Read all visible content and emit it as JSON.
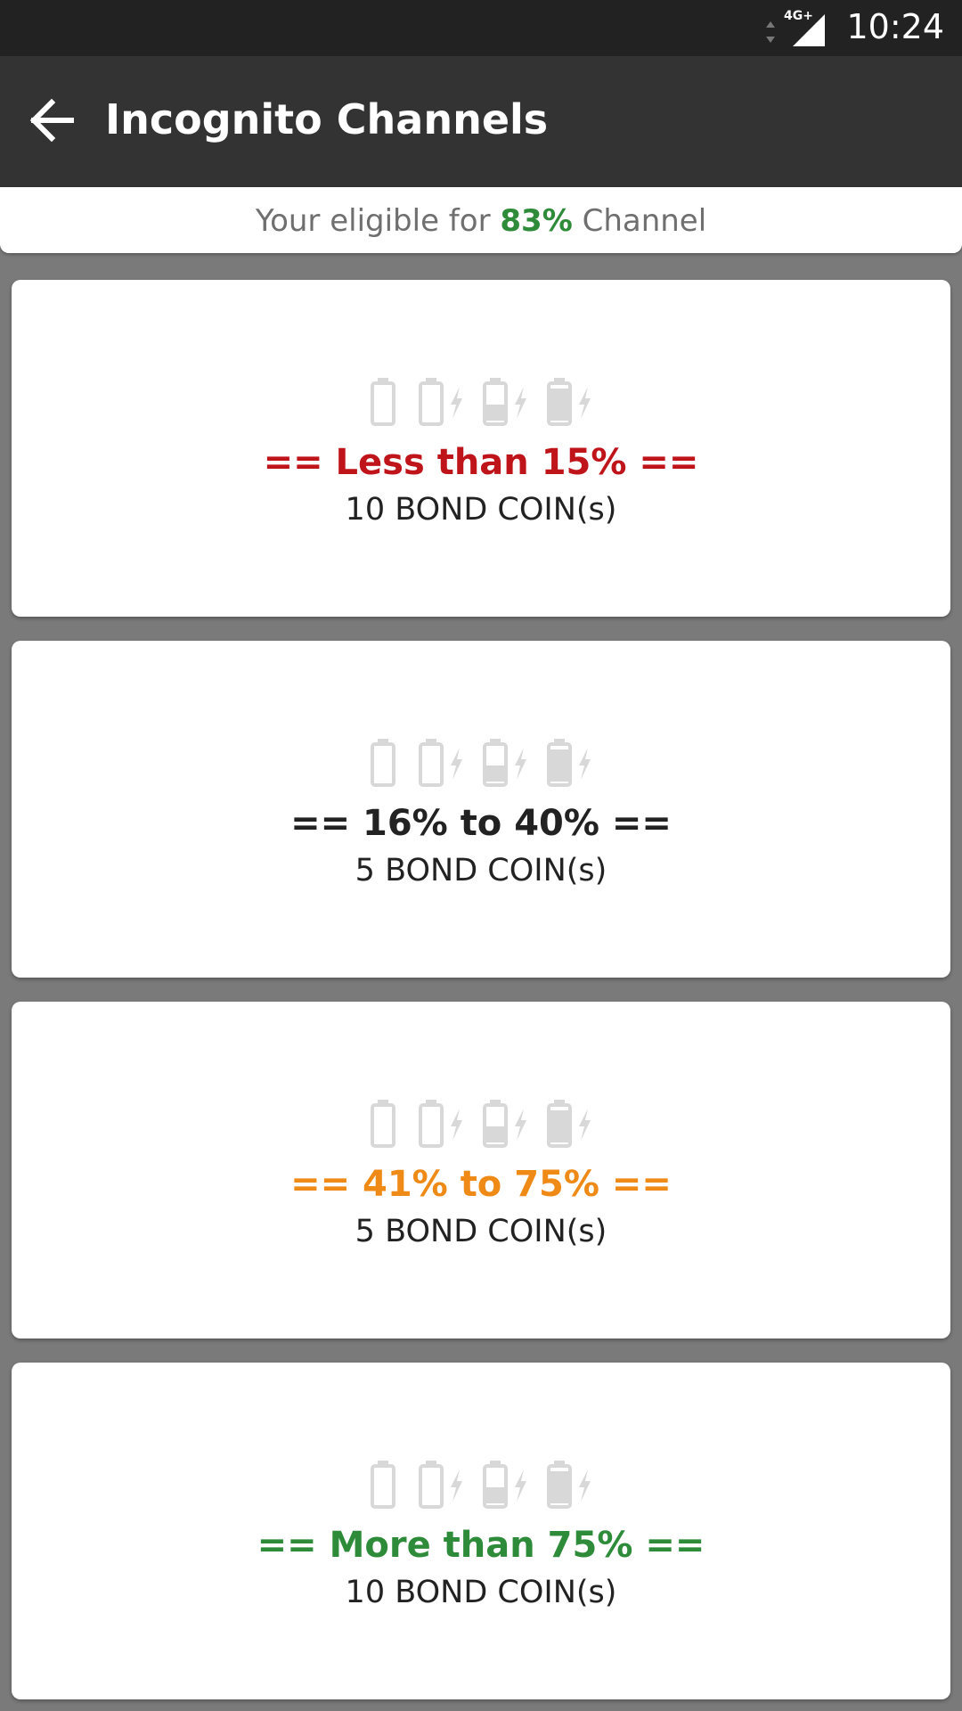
{
  "status_bar": {
    "network": "4G+",
    "time": "10:24"
  },
  "app_bar": {
    "title": "Incognito Channels",
    "back_icon": "arrow-back-icon"
  },
  "eligibility": {
    "prefix": "Your eligible for ",
    "percent": "83%",
    "suffix": " Channel",
    "percent_color": "#2e8b3a"
  },
  "icons": [
    "battery-empty-icon",
    "battery-charging-low-icon",
    "battery-charging-half-icon",
    "battery-charging-full-icon"
  ],
  "cards": [
    {
      "title": "== Less than 15% ==",
      "coins": "10 BOND COIN(s)",
      "color": "#c0141b"
    },
    {
      "title": "== 16% to 40% ==",
      "coins": "5 BOND COIN(s)",
      "color": "#222222"
    },
    {
      "title": "== 41% to 75% ==",
      "coins": "5 BOND COIN(s)",
      "color": "#ef8a17"
    },
    {
      "title": "== More than 75% ==",
      "coins": "10 BOND COIN(s)",
      "color": "#2e8b3a"
    }
  ]
}
